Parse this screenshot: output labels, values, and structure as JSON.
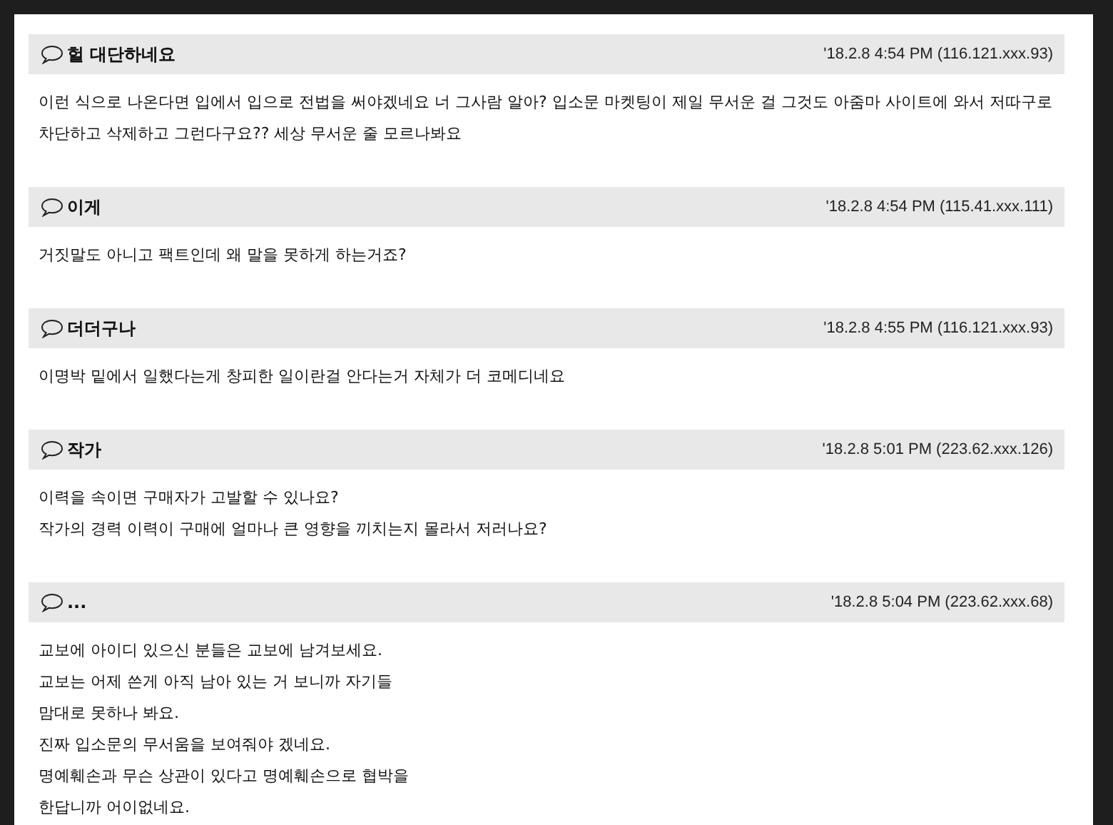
{
  "comments": [
    {
      "author": "헐 대단하네요",
      "meta": "'18.2.8 4:54 PM (116.121.xxx.93)",
      "lines": [
        "이런 식으로 나온다면 입에서 입으로 전법을 써야겠네요 너 그사람 알아? 입소문 마켓팅이 제일 무서운 걸 그것도 아줌마 사이트에 와서 저따구로 차단하고 삭제하고 그런다구요?? 세상 무서운 줄 모르나봐요"
      ]
    },
    {
      "author": "이게",
      "meta": "'18.2.8 4:54 PM (115.41.xxx.111)",
      "lines": [
        "거짓말도 아니고 팩트인데 왜 말을 못하게 하는거죠?"
      ]
    },
    {
      "author": "더더구나",
      "meta": "'18.2.8 4:55 PM (116.121.xxx.93)",
      "lines": [
        "이명박 밑에서 일했다는게 창피한 일이란걸 안다는거 자체가 더 코메디네요"
      ]
    },
    {
      "author": "작가",
      "meta": "'18.2.8 5:01 PM (223.62.xxx.126)",
      "lines": [
        "이력을 속이면 구매자가 고발할 수 있나요?",
        "작가의 경력 이력이 구매에 얼마나 큰 영향을 끼치는지 몰라서 저러나요?"
      ]
    },
    {
      "author": "...",
      "meta": "'18.2.8 5:04 PM (223.62.xxx.68)",
      "lines": [
        "교보에 아이디 있으신 분들은 교보에 남겨보세요.",
        "교보는 어제 쓴게 아직 남아 있는 거 보니까 자기들",
        "맘대로 못하나 봐요.",
        "진짜 입소문의 무서움을 보여줘야 겠네요.",
        "명예훼손과 무슨 상관이 있다고 명예훼손으로 협박을",
        "한답니까 어이없네요."
      ]
    }
  ]
}
